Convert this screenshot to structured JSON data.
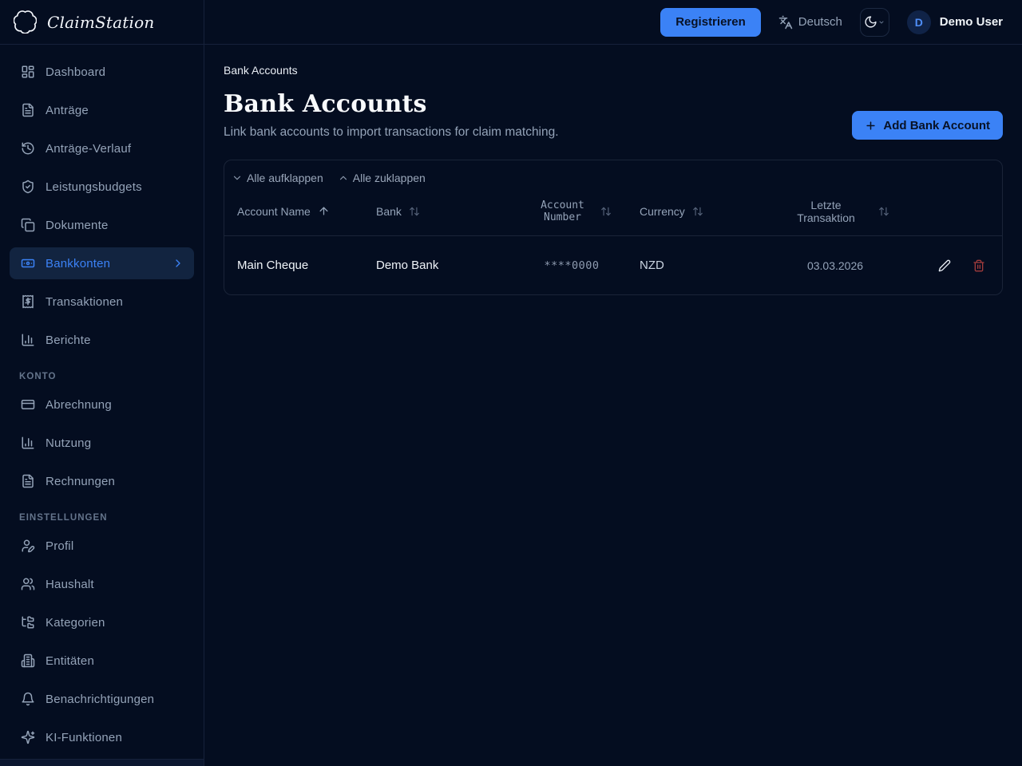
{
  "brand": {
    "name": "ClaimStation",
    "logo_icon": "scalloped-circle-icon"
  },
  "header": {
    "register_button": "Registrieren",
    "language": {
      "label": "Deutsch",
      "icon": "languages-icon"
    },
    "theme_toggle_icon": "moon-icon",
    "user": {
      "initial": "D",
      "name": "Demo User"
    }
  },
  "sidebar": {
    "main_items": [
      {
        "label": "Dashboard",
        "icon": "layout-dashboard-icon"
      },
      {
        "label": "Anträge",
        "icon": "file-text-icon"
      },
      {
        "label": "Anträge-Verlauf",
        "icon": "history-icon"
      },
      {
        "label": "Leistungsbudgets",
        "icon": "shield-check-icon"
      },
      {
        "label": "Dokumente",
        "icon": "copy-icon"
      },
      {
        "label": "Bankkonten",
        "icon": "banknote-icon",
        "active": true
      },
      {
        "label": "Transaktionen",
        "icon": "receipt-icon"
      },
      {
        "label": "Berichte",
        "icon": "bar-chart-icon"
      }
    ],
    "konto_section": "Konto",
    "konto_items": [
      {
        "label": "Abrechnung",
        "icon": "credit-card-icon"
      },
      {
        "label": "Nutzung",
        "icon": "bar-chart-icon"
      },
      {
        "label": "Rechnungen",
        "icon": "file-text-icon"
      }
    ],
    "einstellungen_section": "Einstellungen",
    "einstellungen_items": [
      {
        "label": "Profil",
        "icon": "user-pen-icon"
      },
      {
        "label": "Haushalt",
        "icon": "users-icon"
      },
      {
        "label": "Kategorien",
        "icon": "folder-tree-icon"
      },
      {
        "label": "Entitäten",
        "icon": "building-icon"
      },
      {
        "label": "Benachrichtigungen",
        "icon": "bell-icon"
      },
      {
        "label": "KI-Funktionen",
        "icon": "sparkles-icon"
      }
    ]
  },
  "main": {
    "breadcrumb": "Bank Accounts",
    "title": "Bank Accounts",
    "subtitle": "Link bank accounts to import transactions for claim matching.",
    "add_button": "Add Bank Account",
    "table": {
      "expand_all": "Alle aufklappen",
      "collapse_all": "Alle zuklappen",
      "columns": [
        "Account Name",
        "Bank",
        "Account Number",
        "Currency",
        "Letzte Transaktion"
      ],
      "sort": {
        "column": "Account Name",
        "direction": "asc"
      },
      "rows": [
        {
          "account_name": "Main Cheque",
          "bank": "Demo Bank",
          "account_number": "****0000",
          "currency": "NZD",
          "last_transaction": "03.03.2026"
        }
      ]
    }
  },
  "colors": {
    "background": "#040d20",
    "accent": "#3b82f6",
    "active_item_bg": "#122440",
    "danger": "#a23c3c",
    "border": "#1a2438"
  }
}
